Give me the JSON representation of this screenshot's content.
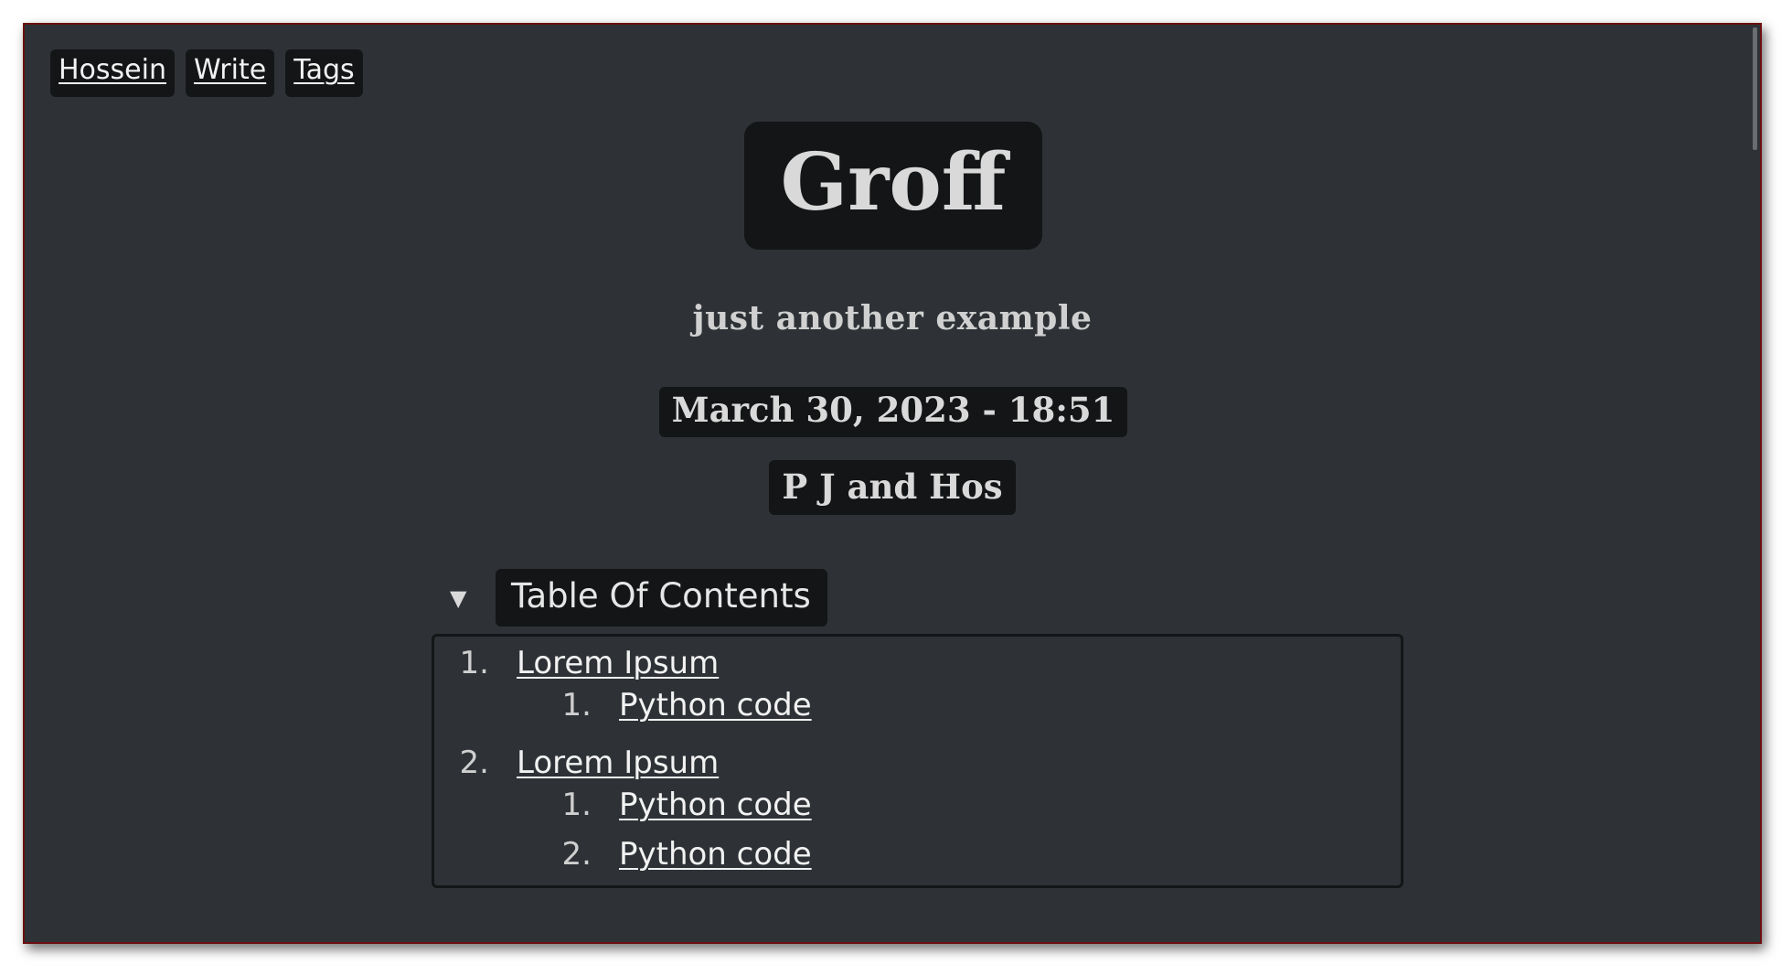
{
  "nav": {
    "items": [
      {
        "label": "Hossein"
      },
      {
        "label": "Write"
      },
      {
        "label": "Tags"
      }
    ]
  },
  "header": {
    "title": "Groff",
    "subtitle": "just another example",
    "date": "March 30, 2023 - 18:51",
    "author": "P J and Hos"
  },
  "toc": {
    "summary_label": "Table Of Contents",
    "arrow_icon": "triangle-down-icon",
    "sections": [
      {
        "number": "1.",
        "label": "Lorem Ipsum",
        "children": [
          {
            "number": "1.",
            "label": "Python code"
          }
        ]
      },
      {
        "number": "2.",
        "label": "Lorem Ipsum",
        "children": [
          {
            "number": "1.",
            "label": "Python code"
          },
          {
            "number": "2.",
            "label": "Python code"
          }
        ]
      }
    ]
  },
  "colors": {
    "background": "#2e3236",
    "box": "#131516",
    "text": "#d9d9d9",
    "window_border": "#6b0f0f"
  }
}
